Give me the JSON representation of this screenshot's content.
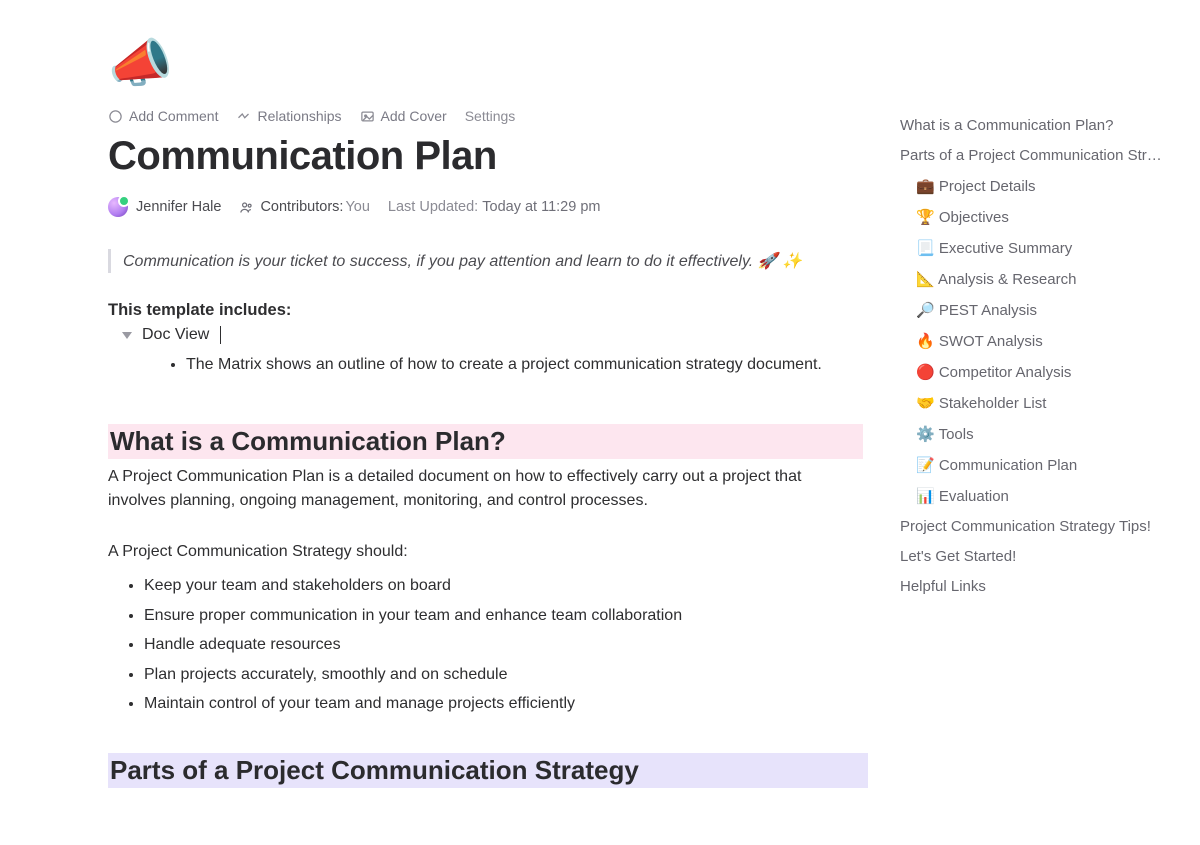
{
  "toolbar": {
    "comment": "Add Comment",
    "relationships": "Relationships",
    "cover": "Add Cover",
    "settings": "Settings"
  },
  "title": "Communication Plan",
  "author": "Jennifer Hale",
  "contributors_label": "Contributors:",
  "contributors_value": "You",
  "updated_label": "Last Updated:",
  "updated_value": "Today at 11:29 pm",
  "quote": "Communication is your ticket to success, if you pay attention and learn to do it effectively. 🚀 ✨",
  "template_includes_label": "This template includes:",
  "doc_view_label": "Doc View",
  "matrix_item": "The Matrix shows an outline of how to create a project communication strategy document.",
  "h_what": "What is a Communication Plan?",
  "p_what": "A Project Communication Plan is a detailed document on how to effectively carry out a project that involves planning, ongoing management, monitoring, and control processes.",
  "p_should": "A Project Communication Strategy should:",
  "should_items": [
    "Keep your team and stakeholders on board",
    "Ensure proper communication in your team and enhance team collaboration",
    "Handle adequate resources",
    "Plan projects accurately, smoothly and on schedule",
    "Maintain control of your team and manage projects efficiently"
  ],
  "h_parts": "Parts of a Project Communication Strategy",
  "sidebar": {
    "l0": "What is a Communication Plan?",
    "l1": "Parts of a Project Communication Strategy",
    "s0": "💼 Project Details",
    "s1": "🏆 Objectives",
    "s2": "📃 Executive Summary",
    "s3": "📐 Analysis & Research",
    "s4": "🔎 PEST Analysis",
    "s5": "🔥 SWOT Analysis",
    "s6": "🔴 Competitor Analysis",
    "s7": "🤝 Stakeholder List",
    "s8": "⚙️ Tools",
    "s9": "📝 Communication Plan",
    "s10": "📊 Evaluation",
    "l2": "Project Communication Strategy Tips!",
    "l3": "Let's Get Started!",
    "l4": "Helpful Links"
  }
}
